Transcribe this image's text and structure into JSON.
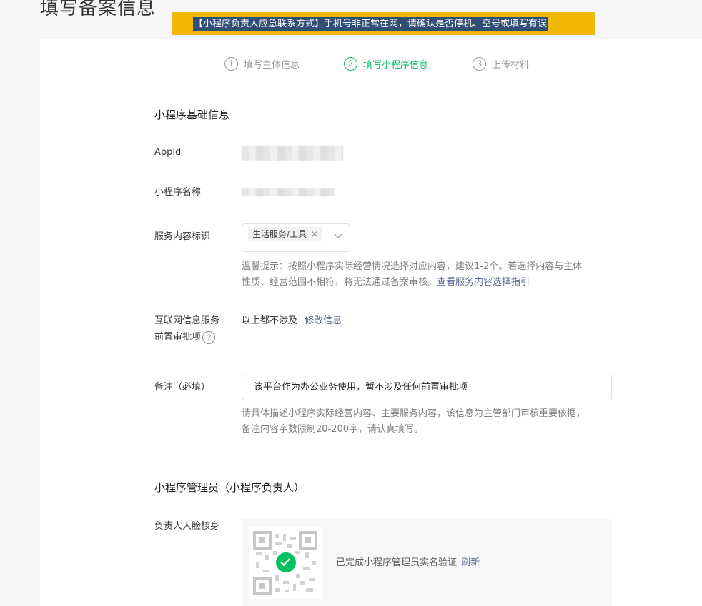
{
  "page": {
    "title": "填写备案信息",
    "alert": "【小程序负责人应急联系方式】手机号非正常在网，请确认是否停机、空号或填写有误"
  },
  "steps": [
    {
      "num": "1",
      "label": "填写主体信息"
    },
    {
      "num": "2",
      "label": "填写小程序信息"
    },
    {
      "num": "3",
      "label": "上传材料"
    }
  ],
  "basic": {
    "section_title": "小程序基础信息",
    "appid_label": "Appid",
    "name_label": "小程序名称",
    "service_label": "服务内容标识",
    "service_tag": "生活服务/工具",
    "service_hint_1": "温馨提示：按照小程序实际经营情况选择对应内容，建议1-2个。若选择内容与主体",
    "service_hint_2": "性质、经营范围不相符，将无法通过备案审核。",
    "service_hint_link": "查看服务内容选择指引",
    "internet_label_1": "互联网信息服务",
    "internet_label_2": "前置审批项",
    "internet_value": "以上都不涉及",
    "internet_edit": "修改信息",
    "remark_label": "备注（必填）",
    "remark_value": "该平台作为办公业务使用，暂不涉及任何前置审批项",
    "remark_hint_1": "请具体描述小程序实际经营内容、主要服务内容，该信息为主管部门审核重要依据，",
    "remark_hint_2": "备注内容字数限制20-200字，请认真填写。"
  },
  "admin": {
    "section_title": "小程序管理员（小程序负责人）",
    "face_label": "负责人人脸核身",
    "verify_text": "已完成小程序管理员实名验证",
    "refresh": "刷新"
  },
  "colors": {
    "accent_green": "#07c160",
    "link_blue": "#576b95",
    "alert_bg": "#f2b705",
    "alert_text_bg": "#2f4f77"
  }
}
